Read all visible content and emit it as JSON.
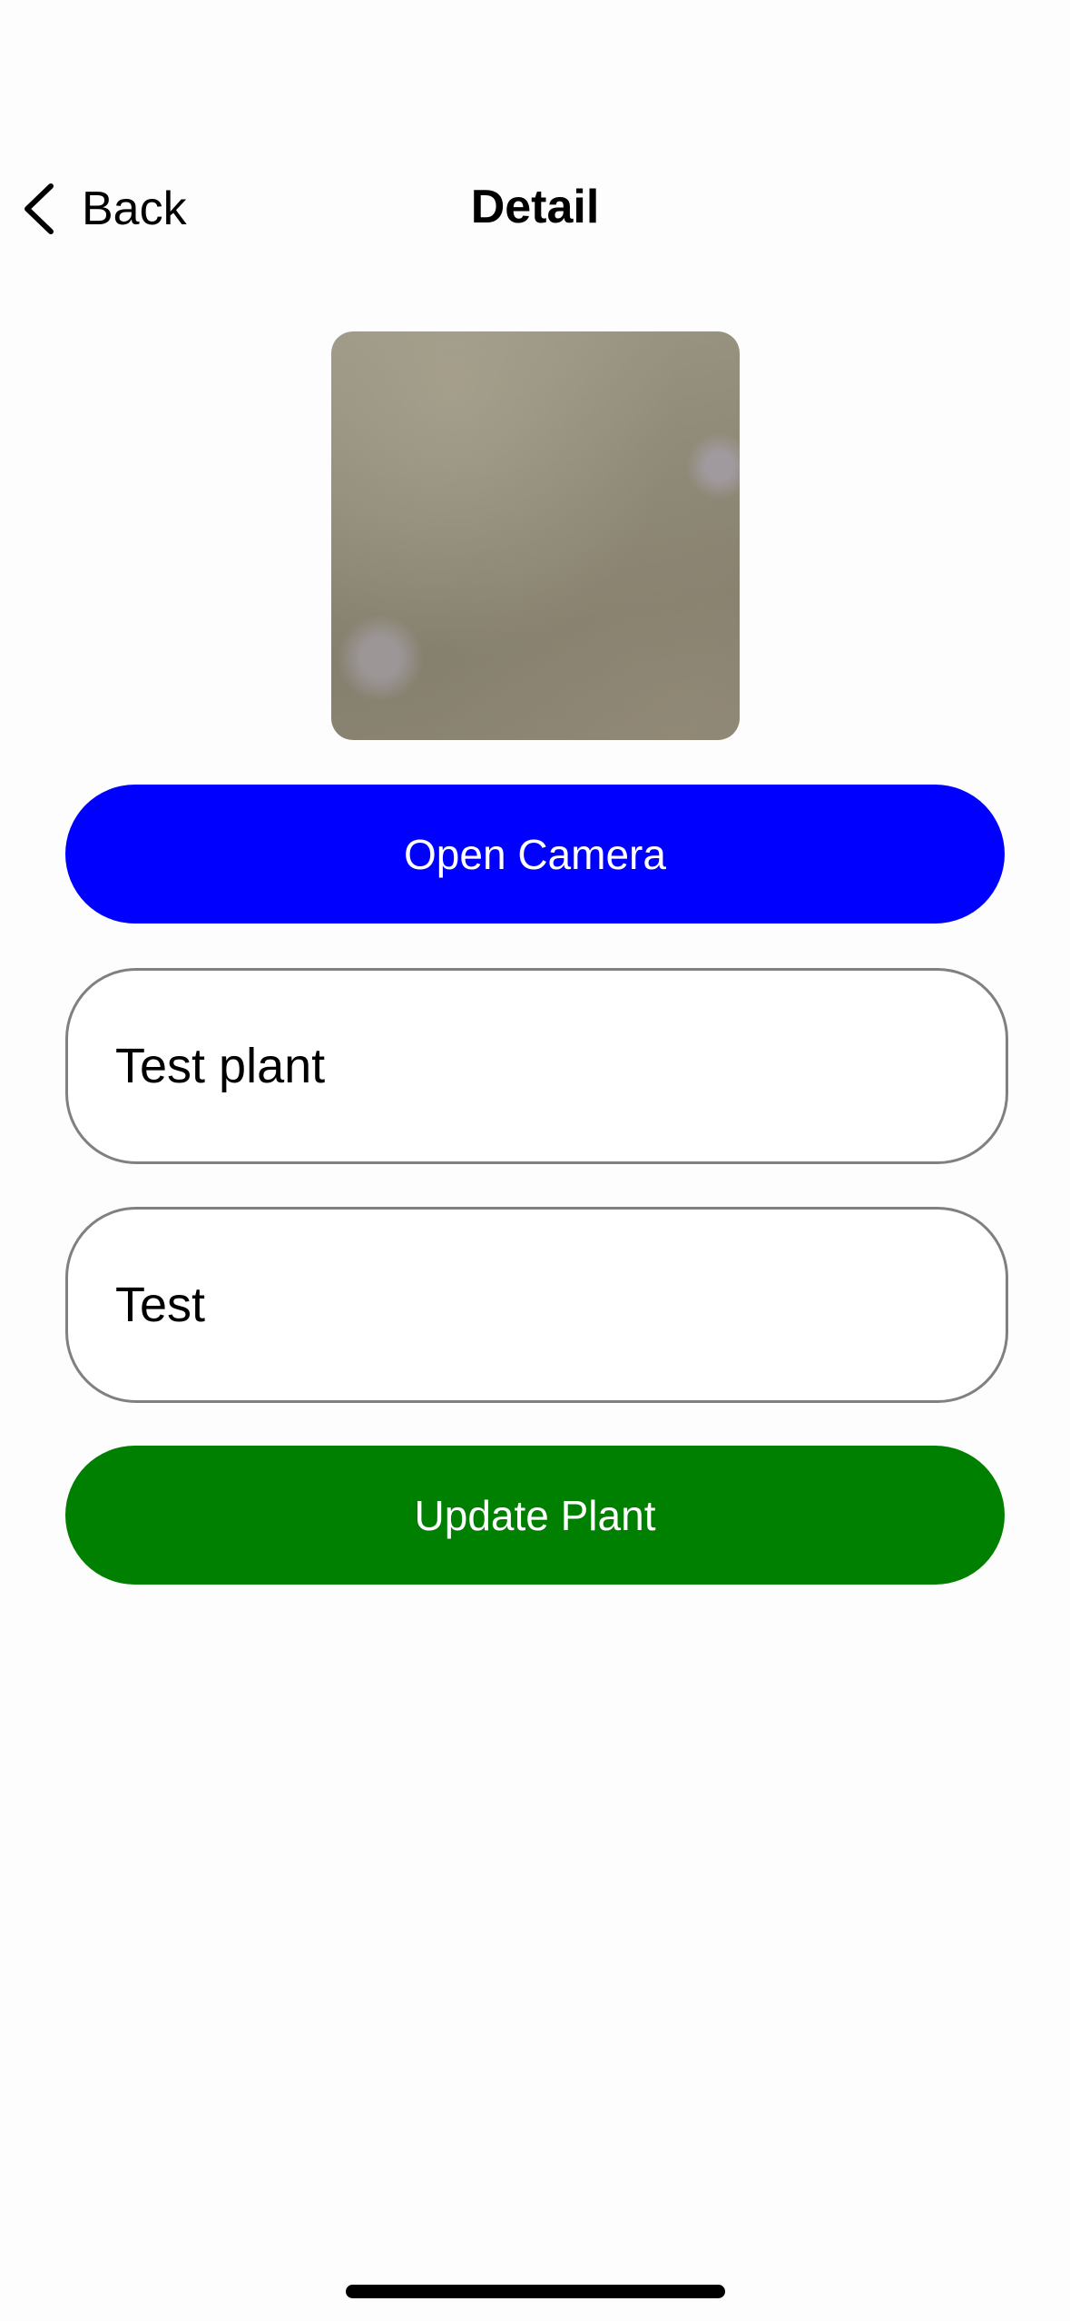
{
  "nav": {
    "back_label": "Back",
    "title": "Detail"
  },
  "icons": {
    "back": "chevron-left-icon"
  },
  "form": {
    "open_camera_label": "Open Camera",
    "name_value": "Test plant",
    "description_value": "Test",
    "update_label": "Update Plant"
  },
  "colors": {
    "open_camera_button": "#0000ff",
    "update_button": "#008000",
    "field_border": "#808080",
    "background": "#fdfdfd"
  }
}
